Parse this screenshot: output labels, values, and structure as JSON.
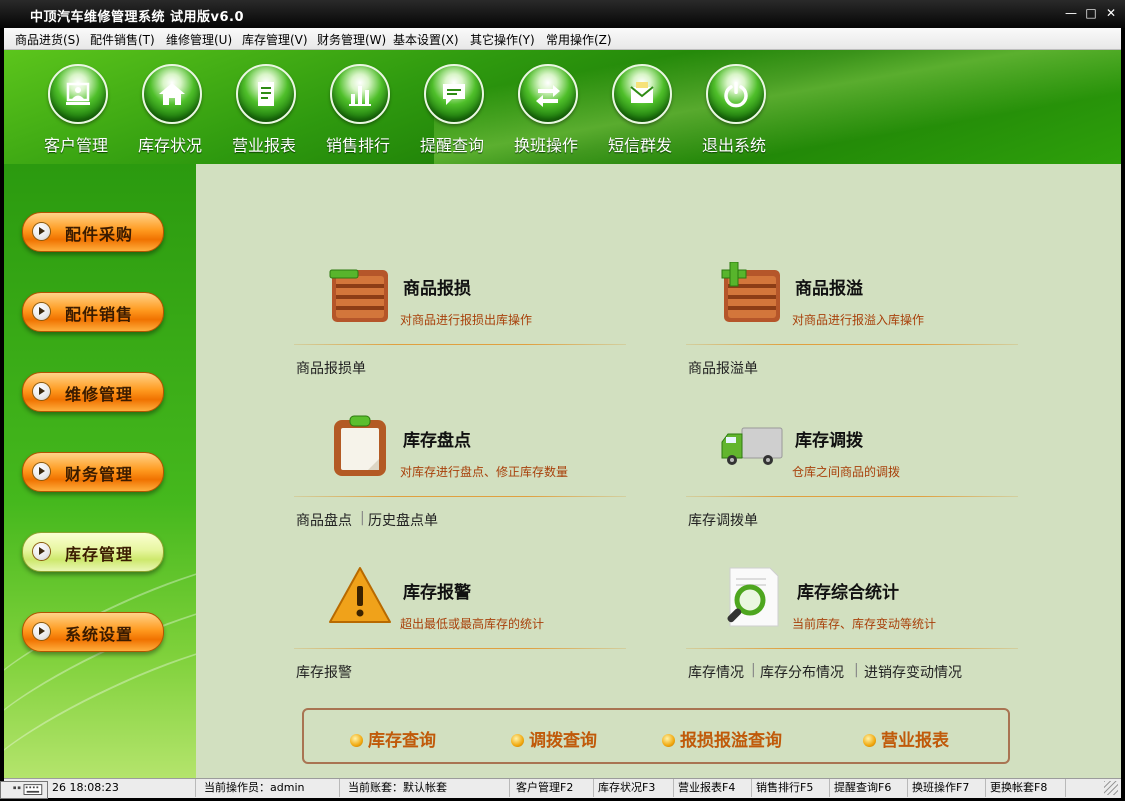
{
  "window": {
    "title": "中顶汽车维修管理系统 试用版v6.0",
    "minimize": "—",
    "maximize": "□",
    "close": "✕"
  },
  "menu": [
    "商品进货(S)",
    "配件销售(T)",
    "维修管理(U)",
    "库存管理(V)",
    "财务管理(W)",
    "基本设置(X)",
    "其它操作(Y)",
    "常用操作(Z)"
  ],
  "toolbar": [
    {
      "label": "客户管理",
      "icon": "customer-icon"
    },
    {
      "label": "库存状况",
      "icon": "home-icon"
    },
    {
      "label": "营业报表",
      "icon": "report-icon"
    },
    {
      "label": "销售排行",
      "icon": "bar-chart-icon"
    },
    {
      "label": "提醒查询",
      "icon": "message-icon"
    },
    {
      "label": "换班操作",
      "icon": "swap-arrows-icon"
    },
    {
      "label": "短信群发",
      "icon": "sms-icon"
    },
    {
      "label": "退出系统",
      "icon": "power-icon"
    }
  ],
  "sidebar": [
    {
      "label": "配件采购",
      "active": false
    },
    {
      "label": "配件销售",
      "active": false
    },
    {
      "label": "维修管理",
      "active": false
    },
    {
      "label": "财务管理",
      "active": false
    },
    {
      "label": "库存管理",
      "active": true
    },
    {
      "label": "系统设置",
      "active": false
    }
  ],
  "cards": [
    {
      "title": "商品报损",
      "desc": "对商品进行报损出库操作",
      "icon": "crate-minus-icon",
      "links": [
        "商品报损单"
      ]
    },
    {
      "title": "商品报溢",
      "desc": "对商品进行报溢入库操作",
      "icon": "crate-plus-icon",
      "links": [
        "商品报溢单"
      ]
    },
    {
      "title": "库存盘点",
      "desc": "对库存进行盘点、修正库存数量",
      "icon": "clipboard-icon",
      "links": [
        "商品盘点",
        "历史盘点单"
      ]
    },
    {
      "title": "库存调拨",
      "desc": "仓库之间商品的调拨",
      "icon": "truck-icon",
      "links": [
        "库存调拨单"
      ]
    },
    {
      "title": "库存报警",
      "desc": "超出最低或最高库存的统计",
      "icon": "warning-icon",
      "links": [
        "库存报警"
      ]
    },
    {
      "title": "库存综合统计",
      "desc": "当前库存、库存变动等统计",
      "icon": "magnifier-icon",
      "links": [
        "库存情况",
        "库存分布情况",
        "进销存变动情况"
      ]
    }
  ],
  "quick_queries": [
    "库存查询",
    "调拨查询",
    "报损报溢查询",
    "营业报表"
  ],
  "status": {
    "datetime": "26 18:08:23",
    "operator": "当前操作员：admin",
    "account": "当前账套：默认帐套",
    "shortcuts": [
      "客户管理F2",
      "库存状况F3",
      "营业报表F4",
      "销售排行F5",
      "提醒查询F6",
      "换班操作F7",
      "更换帐套F8"
    ]
  }
}
